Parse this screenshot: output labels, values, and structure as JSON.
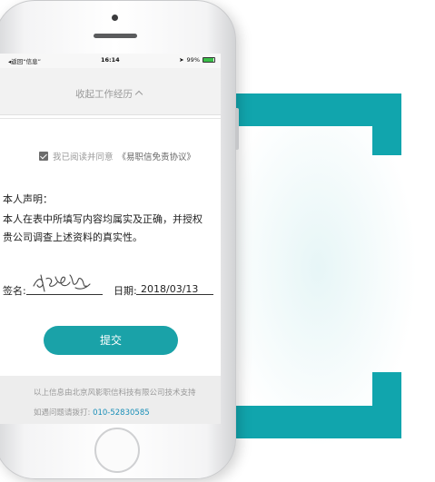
{
  "status_bar": {
    "back_label": "◂返回“信息”",
    "time": "16:14",
    "battery": "99%"
  },
  "collapse": {
    "label": "收起工作经历"
  },
  "agreement": {
    "prefix": "我已阅读并同意",
    "link": "《易职信免责协议》",
    "checked": true
  },
  "declaration": {
    "title": "本人声明：",
    "line1": "本人在表中所填写内容均属实及正确，并授权",
    "line2": "贵公司调查上述资料的真实性。"
  },
  "signature": {
    "label": "签名:"
  },
  "date": {
    "label": "日期:",
    "value": "2018/03/13"
  },
  "submit_label": "提交",
  "footer": {
    "support": "以上信息由北京风影职信科技有限公司技术支持",
    "contact_prefix": "如遇问题请拨打:",
    "phone": "010-52830585"
  },
  "colors": {
    "accent": "#1aa2a8",
    "bracket": "#11a5ad",
    "link": "#1a8fb8"
  }
}
